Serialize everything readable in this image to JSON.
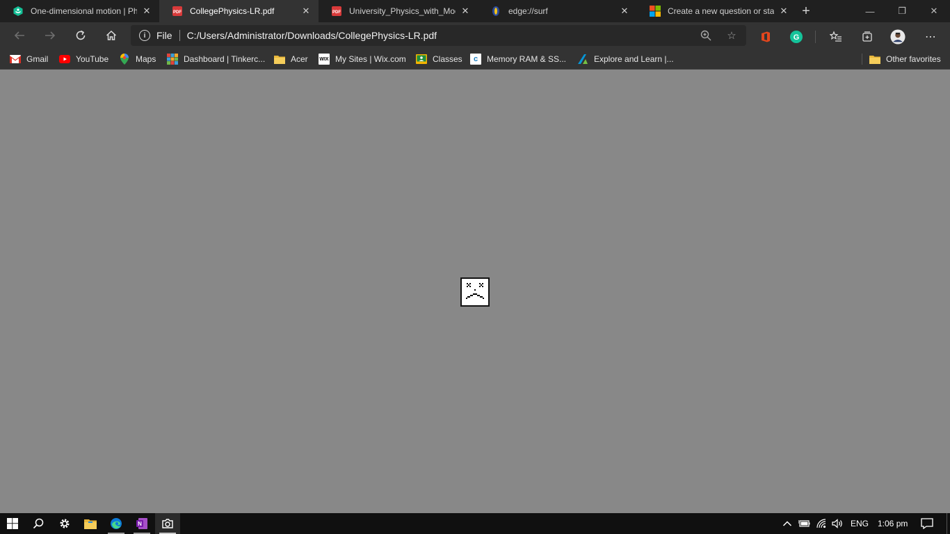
{
  "tabs": [
    {
      "title": "One-dimensional motion | Phy",
      "favicon": "khan-academy-icon",
      "active": false
    },
    {
      "title": "CollegePhysics-LR.pdf",
      "favicon": "pdf-icon",
      "active": true
    },
    {
      "title": "University_Physics_with_Mode",
      "favicon": "pdf-icon",
      "active": false
    },
    {
      "title": "edge://surf",
      "favicon": "surf-icon",
      "active": false
    },
    {
      "title": "Create a new question or start",
      "favicon": "microsoft-icon",
      "active": false
    }
  ],
  "address_bar": {
    "scheme_label": "File",
    "url": "C:/Users/Administrator/Downloads/CollegePhysics-LR.pdf"
  },
  "favorites": [
    {
      "label": "Gmail",
      "icon": "gmail-icon"
    },
    {
      "label": "YouTube",
      "icon": "youtube-icon"
    },
    {
      "label": "Maps",
      "icon": "maps-icon"
    },
    {
      "label": "Dashboard | Tinkerc...",
      "icon": "tinkercad-icon"
    },
    {
      "label": "Acer",
      "icon": "folder-icon"
    },
    {
      "label": "My Sites | Wix.com",
      "icon": "wix-icon"
    },
    {
      "label": "Classes",
      "icon": "classroom-icon"
    },
    {
      "label": "Memory RAM & SS...",
      "icon": "crucial-icon"
    },
    {
      "label": "Explore and Learn |...",
      "icon": "autodesk-icon"
    }
  ],
  "other_favorites": "Other favorites",
  "taskbar": {
    "language": "ENG",
    "time": "1:06 pm"
  },
  "colors": {
    "tab_strip": "#202020",
    "toolbar": "#333333",
    "content_bg": "#888888",
    "taskbar": "#101010"
  }
}
